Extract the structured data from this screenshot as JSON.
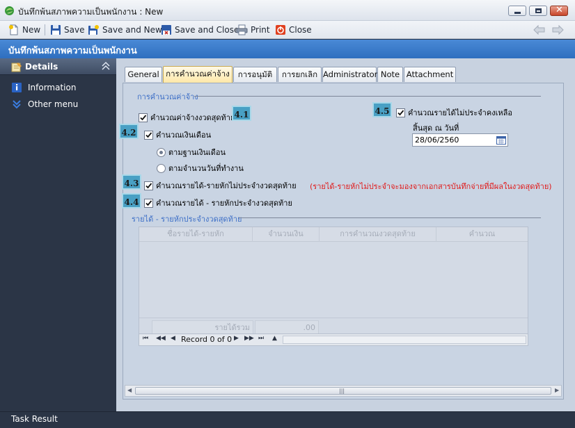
{
  "window": {
    "title": "บันทึกพ้นสภาพความเป็นพนักงาน : New"
  },
  "toolbar": {
    "new_label": "New",
    "save_label": "Save",
    "save_new_label": "Save and New",
    "save_close_label": "Save and Close",
    "print_label": "Print",
    "close_label": "Close"
  },
  "banner": {
    "title": "บันทึกพ้นสภาพความเป็นพนักงาน"
  },
  "sidebar": {
    "header": "Details",
    "items": [
      {
        "label": "Information",
        "icon": "info-icon"
      },
      {
        "label": "Other menu",
        "icon": "double-chevron-down-icon"
      }
    ]
  },
  "tabs": [
    {
      "label": "General"
    },
    {
      "label": "การคำนวณค่าจ้าง"
    },
    {
      "label": "การอนุมัติ"
    },
    {
      "label": "การยกเลิก"
    },
    {
      "label": "Administrator"
    },
    {
      "label": "Note"
    },
    {
      "label": "Attachment"
    }
  ],
  "calc": {
    "group_title": "การคำนวณค่าจ้าง",
    "last_period_wage": {
      "label": "คำนวณค่าจ้างงวดสุดท้าย",
      "checked": true
    },
    "calc_salary": {
      "label": "คำนวณเงินเดือน",
      "checked": true
    },
    "radio_base_salary": {
      "label": "ตามฐานเงินเดือน",
      "selected": true
    },
    "radio_work_days": {
      "label": "ตามจำนวนวันที่ทำงาน",
      "selected": false
    },
    "non_recurring_last": {
      "label": "คำนวณรายได้-รายหักไม่ประจำงวดสุดท้าย",
      "checked": true
    },
    "recurring_last": {
      "label": "คำนวณรายได้ - รายหักประจำงวดสุดท้าย",
      "checked": true
    },
    "non_recurring_remaining": {
      "label": "คำนวณรายได้ไม่ประจำคงเหลือ",
      "checked": true
    },
    "end_date_label": "สิ้นสุด ณ วันที่",
    "end_date_value": "28/06/2560",
    "note": "(รายได้-รายหักไม่ประจำจะมองจากเอกสารบันทึกจ่ายที่มีผลในงวดสุดท้าย)",
    "badges": [
      "4.1",
      "4.2",
      "4.3",
      "4.4",
      "4.5"
    ]
  },
  "grid": {
    "group_title": "รายได้ - รายหักประจำงวดสุดท้าย",
    "columns": [
      "ชื่อรายได้-รายหัก",
      "จำนวนเงิน",
      "การคำนวณงวดสุดท้าย",
      "คำนวณ"
    ],
    "footer_label": "รายได้รวม",
    "footer_value": ".00",
    "record_text": "Record 0 of 0"
  },
  "status": {
    "label": "Task Result"
  }
}
